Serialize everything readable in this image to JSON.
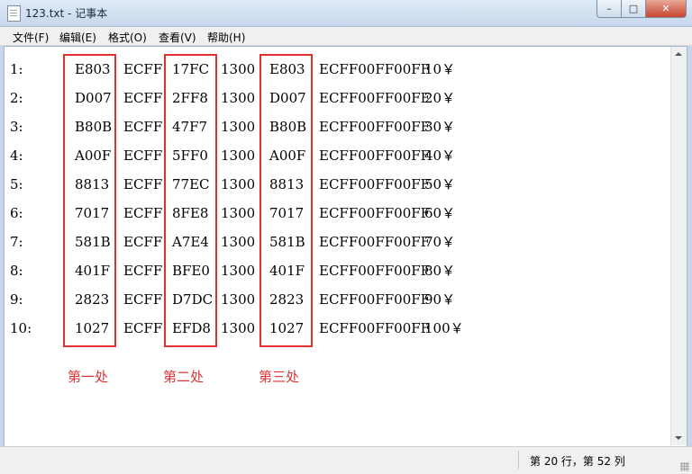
{
  "window": {
    "title": "123.txt - 记事本",
    "min_glyph": "–",
    "max_glyph": "□",
    "close_glyph": "✕"
  },
  "menu": [
    "文件(F)",
    "编辑(E)",
    "格式(O)",
    "查看(V)",
    "帮助(H)"
  ],
  "lines": [
    {
      "num": "1:",
      "a": "E803",
      "b": "ECFF",
      "c": "17FC",
      "d": "1300",
      "e": "E803",
      "f": "ECFF00FF00FF",
      "g": "10￥"
    },
    {
      "num": "2:",
      "a": "D007",
      "b": "ECFF",
      "c": "2FF8",
      "d": "1300",
      "e": "D007",
      "f": "ECFF00FF00FF",
      "g": "20￥"
    },
    {
      "num": "3:",
      "a": "B80B",
      "b": "ECFF",
      "c": "47F7",
      "d": "1300",
      "e": "B80B",
      "f": "ECFF00FF00FF",
      "g": "30￥"
    },
    {
      "num": "4:",
      "a": "A00F",
      "b": "ECFF",
      "c": "5FF0",
      "d": "1300",
      "e": "A00F",
      "f": "ECFF00FF00FF",
      "g": "40￥"
    },
    {
      "num": "5:",
      "a": "8813",
      "b": "ECFF",
      "c": "77EC",
      "d": "1300",
      "e": "8813",
      "f": "ECFF00FF00FF",
      "g": "50￥"
    },
    {
      "num": "6:",
      "a": "7017",
      "b": "ECFF",
      "c": "8FE8",
      "d": "1300",
      "e": "7017",
      "f": "ECFF00FF00FF",
      "g": "60￥"
    },
    {
      "num": "7:",
      "a": "581B",
      "b": "ECFF",
      "c": "A7E4",
      "d": "1300",
      "e": "581B",
      "f": "ECFF00FF00FF",
      "g": "70￥"
    },
    {
      "num": "8:",
      "a": "401F",
      "b": "ECFF",
      "c": "BFE0",
      "d": "1300",
      "e": "401F",
      "f": "ECFF00FF00FF",
      "g": "80￥"
    },
    {
      "num": "9:",
      "a": "2823",
      "b": "ECFF",
      "c": "D7DC",
      "d": "1300",
      "e": "2823",
      "f": "ECFF00FF00FF",
      "g": "90￥"
    },
    {
      "num": "10:",
      "a": "1027",
      "b": "ECFF",
      "c": "EFD8",
      "d": "1300",
      "e": "1027",
      "f": "ECFF00FF00FF",
      "g": "100￥"
    }
  ],
  "annotations": [
    "第一处",
    "第二处",
    "第三处"
  ],
  "status": {
    "position": "第 20 行，第 52 列"
  },
  "colors": {
    "annotation": "#e03030"
  }
}
